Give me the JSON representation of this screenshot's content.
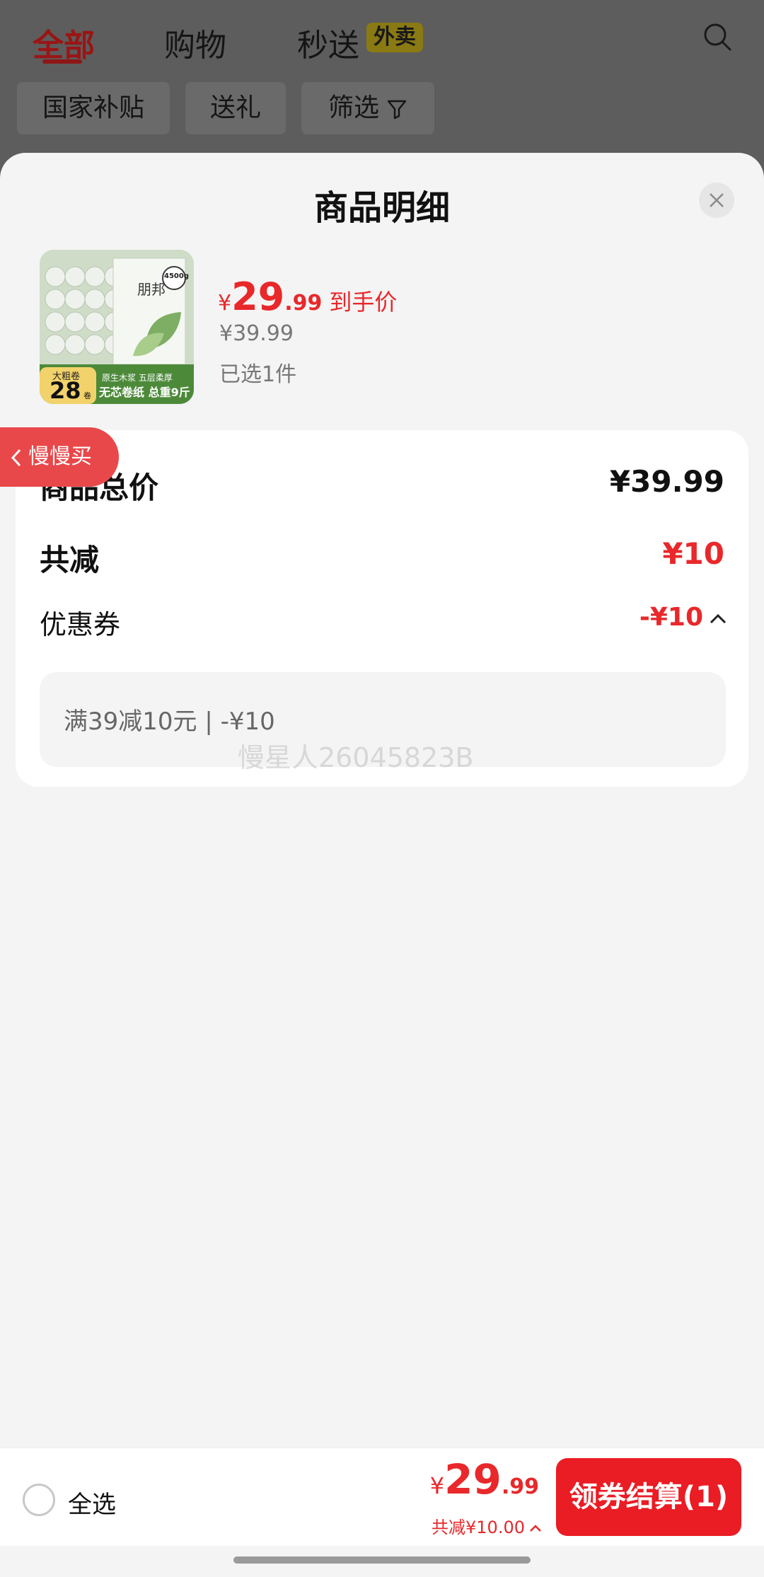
{
  "header": {
    "tabs": [
      {
        "label": "全部"
      },
      {
        "label": "购物"
      },
      {
        "label": "秒送"
      }
    ],
    "tab_badge": "外卖",
    "chips": [
      {
        "label": "国家补贴"
      },
      {
        "label": "送礼"
      },
      {
        "label": "筛选"
      }
    ]
  },
  "sheet": {
    "title": "商品明细",
    "product": {
      "thumb_brand": "朋邦",
      "thumb_weight": "4500g",
      "thumb_badge_top": "大粗卷",
      "thumb_badge_num": "28",
      "thumb_badge_unit": "卷",
      "thumb_banner": "无芯卷纸 总重9斤",
      "thumb_banner_sub": "原生木浆 五层柔厚",
      "price_yen": "¥",
      "price_int": "29",
      "price_dec": ".99",
      "price_label": "到手价",
      "original_price": "¥39.99",
      "selected_count": "已选1件"
    },
    "summary": {
      "total_label": "商品总价",
      "total_value": "¥39.99",
      "reduce_label": "共减",
      "reduce_value": "¥10",
      "coupon_label": "优惠券",
      "coupon_value": "-¥10",
      "coupon_detail": "满39减10元 | -¥10"
    },
    "watermark": "慢星人26045823B",
    "slow_buy": "慢慢买"
  },
  "bottom": {
    "select_all": "全选",
    "total_yen": "¥",
    "total_int": "29",
    "total_dec": ".99",
    "discount": "共减¥10.00",
    "checkout": "领券结算(1)"
  },
  "colors": {
    "accent_red": "#e8282b",
    "button_red": "#ea1c24"
  }
}
